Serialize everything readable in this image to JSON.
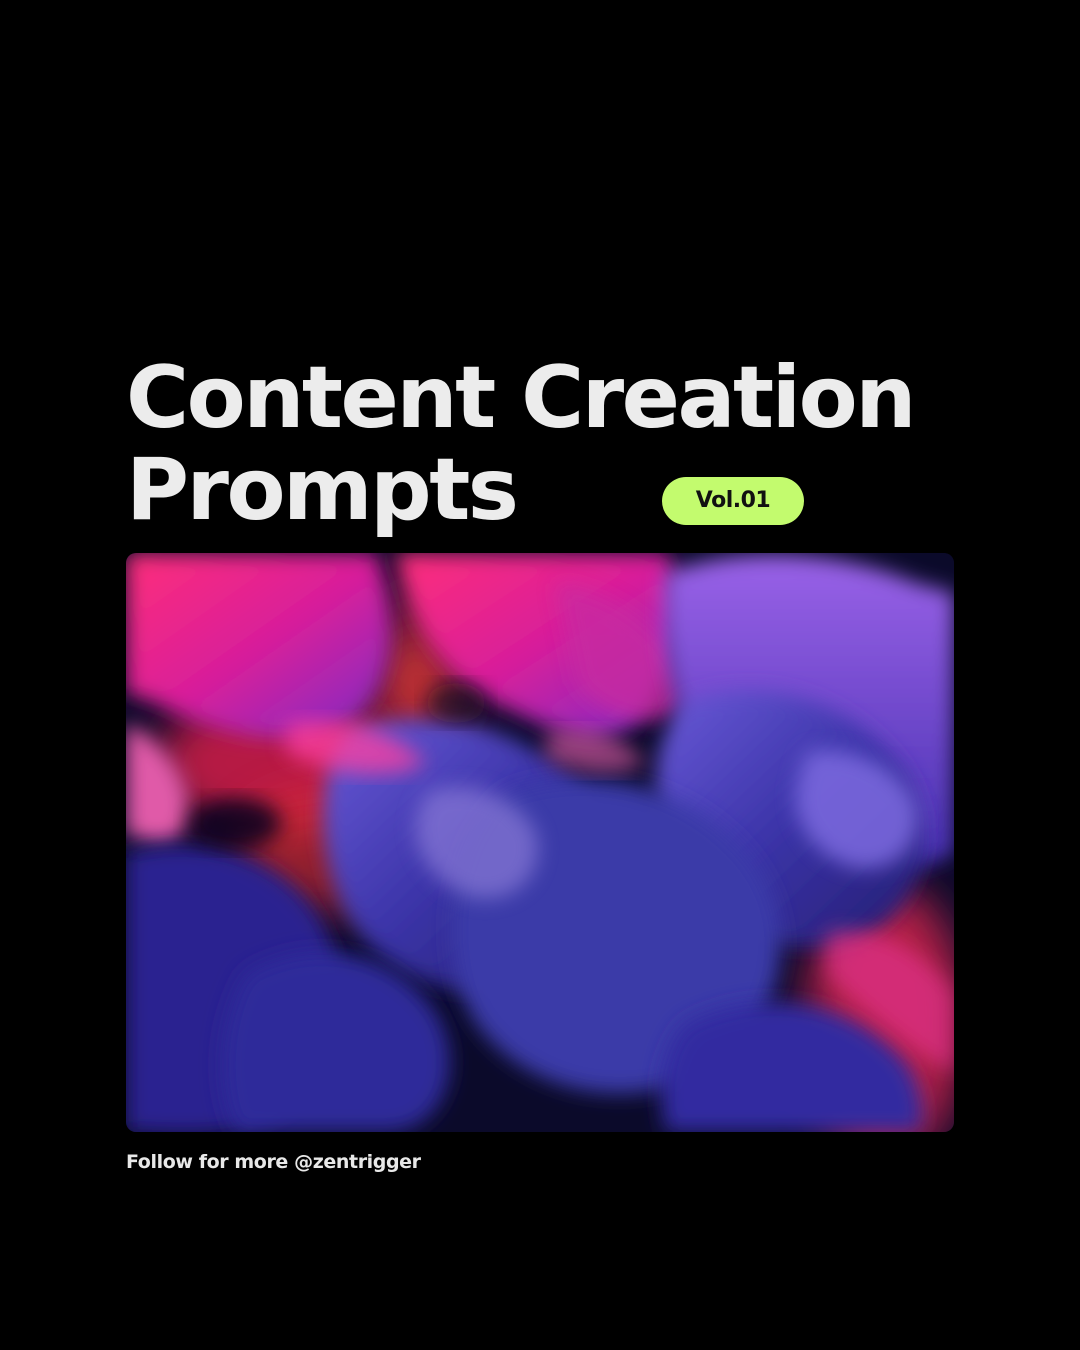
{
  "title": {
    "line1": "Content Creation",
    "line2": "Prompts"
  },
  "badge": {
    "label": "Vol.01",
    "color": "#c3fb6e"
  },
  "footer": {
    "text": "Follow for more @zentrigger"
  },
  "colors": {
    "background": "#000000",
    "title": "#ececec",
    "photo_blue": "#3a2f9a",
    "photo_magenta": "#e0208a",
    "photo_red": "#ff3a40"
  }
}
